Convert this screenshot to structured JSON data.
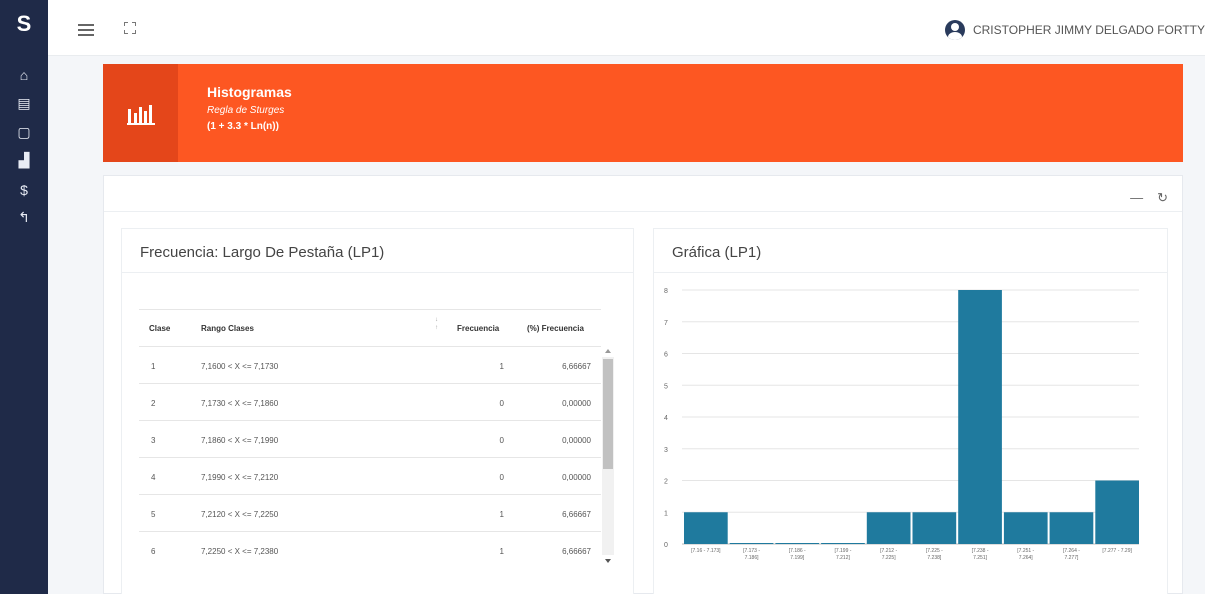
{
  "sidebar": {
    "logo_glyph": "S",
    "items": [
      {
        "icon": "home-icon",
        "glyph": "⌂"
      },
      {
        "icon": "document-icon",
        "glyph": "▤"
      },
      {
        "icon": "note-icon",
        "glyph": "▢"
      },
      {
        "icon": "chart-icon",
        "glyph": "▟"
      },
      {
        "icon": "dollar-icon",
        "glyph": "$"
      },
      {
        "icon": "back-icon",
        "glyph": "↰"
      }
    ]
  },
  "topbar": {
    "user_name": "CRISTOPHER JIMMY DELGADO FORTTY"
  },
  "banner": {
    "title": "Histogramas",
    "subtitle": "Regla de Sturges",
    "formula": "(1 + 3.3 * Ln(n))",
    "color": "#fd5722"
  },
  "outer_tools": {
    "minimize_glyph": "—",
    "refresh_glyph": "↻"
  },
  "table_card": {
    "title": "Frecuencia: Largo De Pestaña (LP1)",
    "columns": [
      "Clase",
      "Rango Clases",
      "Frecuencia",
      "(%) Frecuencia"
    ],
    "rows": [
      [
        "1",
        "7,1600 < X <= 7,1730",
        "1",
        "6,66667"
      ],
      [
        "2",
        "7,1730 < X <= 7,1860",
        "0",
        "0,00000"
      ],
      [
        "3",
        "7,1860 < X <= 7,1990",
        "0",
        "0,00000"
      ],
      [
        "4",
        "7,1990 < X <= 7,2120",
        "0",
        "0,00000"
      ],
      [
        "5",
        "7,2120 < X <= 7,2250",
        "1",
        "6,66667"
      ],
      [
        "6",
        "7,2250 < X <= 7,2380",
        "1",
        "6,66667"
      ]
    ]
  },
  "chart_card": {
    "title": "Gráfica (LP1)"
  },
  "chart_data": {
    "type": "bar",
    "title": "",
    "xlabel": "",
    "ylabel": "",
    "categories": [
      [
        "[7.16 - 7.173]"
      ],
      [
        "[7.173 -",
        "7.186]"
      ],
      [
        "[7.186 -",
        "7.199]"
      ],
      [
        "[7.199 -",
        "7.212]"
      ],
      [
        "[7.212 -",
        "7.225]"
      ],
      [
        "[7.225 -",
        "7.238]"
      ],
      [
        "[7.238 -",
        "7.251]"
      ],
      [
        "[7.251 -",
        "7.264]"
      ],
      [
        "[7.264 -",
        "7.277]"
      ],
      [
        "[7.277 - 7.29]"
      ]
    ],
    "values": [
      1,
      0,
      0,
      0,
      1,
      1,
      8,
      1,
      1,
      2
    ],
    "ylim": [
      0,
      8
    ],
    "yticks": [
      0,
      1,
      2,
      3,
      4,
      5,
      6,
      7,
      8
    ],
    "grid": true,
    "bar_color": "#1f7a9e"
  }
}
